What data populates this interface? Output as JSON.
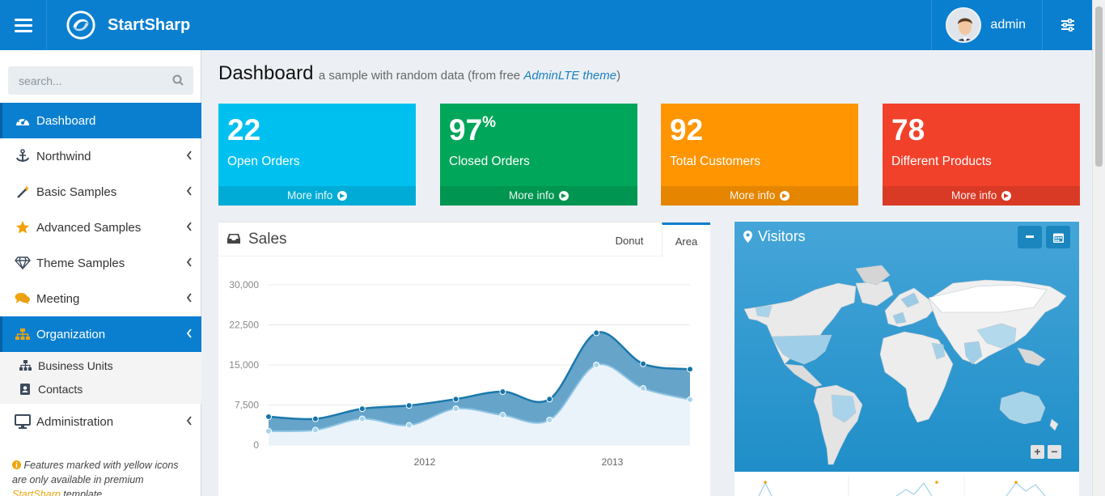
{
  "app": {
    "name": "StartSharp"
  },
  "header": {
    "user_name": "admin"
  },
  "sidebar": {
    "search_placeholder": "search...",
    "items": [
      {
        "label": "Dashboard",
        "icon": "dashboard-icon"
      },
      {
        "label": "Northwind",
        "icon": "anchor-icon"
      },
      {
        "label": "Basic Samples",
        "icon": "magic-wand-icon"
      },
      {
        "label": "Advanced Samples",
        "icon": "star-icon"
      },
      {
        "label": "Theme Samples",
        "icon": "diamond-icon"
      },
      {
        "label": "Meeting",
        "icon": "comments-icon"
      },
      {
        "label": "Organization",
        "icon": "sitemap-icon"
      },
      {
        "label": "Administration",
        "icon": "desktop-icon"
      }
    ],
    "sub_items": [
      {
        "label": "Business Units",
        "icon": "sitemap-icon"
      },
      {
        "label": "Contacts",
        "icon": "contact-book-icon"
      }
    ],
    "note": {
      "line1": "Features marked with yellow icons",
      "line2": "are only available in premium",
      "highlight": "StartSharp",
      "line3_rest": " template"
    }
  },
  "page": {
    "title": "Dashboard",
    "subtitle_prefix": "a sample with random data (from free ",
    "subtitle_link": "AdminLTE theme",
    "subtitle_suffix": ")"
  },
  "stats": [
    {
      "value": "22",
      "suffix": "",
      "label": "Open Orders",
      "more": "More info",
      "color": "#00c0ef"
    },
    {
      "value": "97",
      "suffix": "%",
      "label": "Closed Orders",
      "more": "More info",
      "color": "#00a65a"
    },
    {
      "value": "92",
      "suffix": "",
      "label": "Total Customers",
      "more": "More info",
      "color": "#ff9500"
    },
    {
      "value": "78",
      "suffix": "",
      "label": "Different Products",
      "more": "More info",
      "color": "#f2412a"
    }
  ],
  "sales": {
    "title": "Sales",
    "tabs": [
      "Donut",
      "Area"
    ],
    "active_tab": "Area"
  },
  "visitors": {
    "title": "Visitors",
    "zoom_in": "+",
    "zoom_out": "−"
  },
  "chart_data": {
    "type": "area",
    "title": "Sales",
    "x_ticks": [
      "2012",
      "2013"
    ],
    "ylim": [
      0,
      30000
    ],
    "y_ticks": [
      "0",
      "7,500",
      "15,000",
      "22,500",
      "30,000"
    ],
    "series": [
      {
        "values": [
          5300,
          4900,
          6800,
          7400,
          8600,
          10000,
          8600,
          21000,
          15200,
          14200
        ]
      },
      {
        "values": [
          2600,
          2800,
          4900,
          3700,
          6800,
          5600,
          4700,
          15000,
          10600,
          8500
        ]
      }
    ],
    "grid": true
  }
}
